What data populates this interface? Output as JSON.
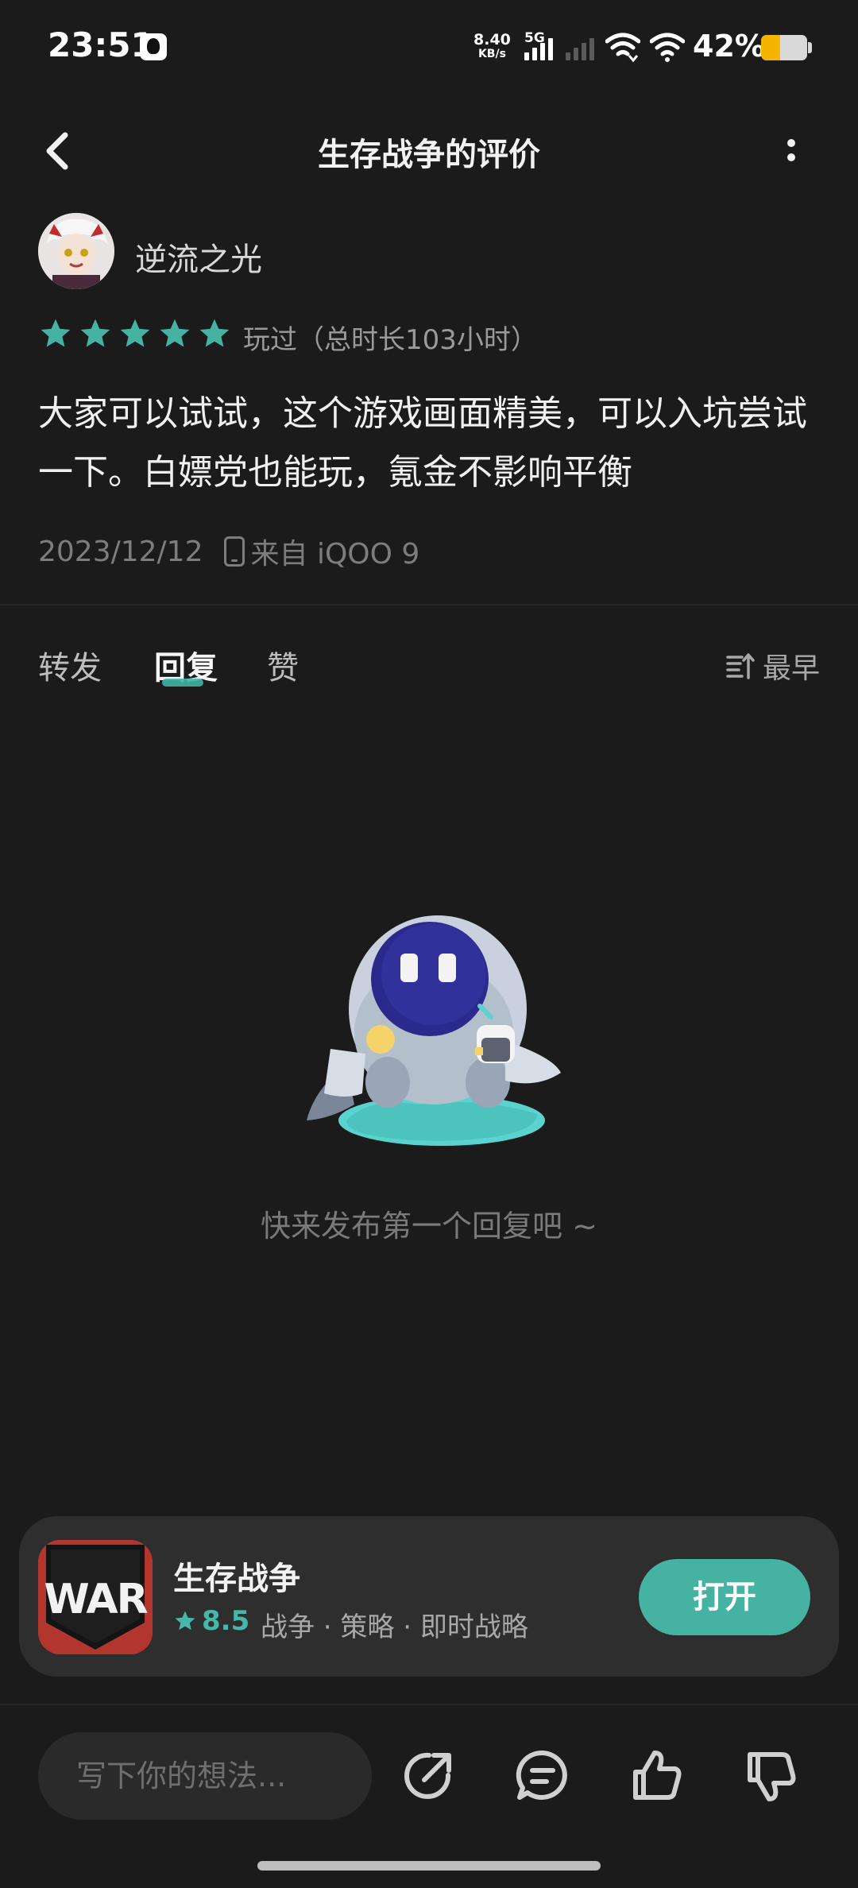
{
  "status_bar": {
    "time": "23:51",
    "net_speed_value": "8.40",
    "net_speed_unit": "KB/s",
    "network_type": "5G",
    "battery_percent_text": "42%",
    "battery_level": 0.42
  },
  "header": {
    "title": "生存战争的评价"
  },
  "review": {
    "username": "逆流之光",
    "stars": 5,
    "played": "玩过（总时长103小时）",
    "text": "大家可以试试，这个游戏画面精美，可以入坑尝试一下。白嫖党也能玩，氪金不影响平衡",
    "date": "2023/12/12",
    "device": "来自 iQOO 9"
  },
  "tabs": {
    "items": [
      {
        "label": "转发"
      },
      {
        "label": "回复"
      },
      {
        "label": "赞"
      }
    ],
    "active_index": 1,
    "sort_label": "最早"
  },
  "empty_state": {
    "text": "快来发布第一个回复吧 ~"
  },
  "game_card": {
    "name": "生存战争",
    "rating": "8.5",
    "tags": "战争 · 策略 · 即时战略",
    "open_label": "打开",
    "icon_text": "WAR"
  },
  "bottom_bar": {
    "input_placeholder": "写下你的想法..."
  },
  "colors": {
    "accent": "#45b2a2",
    "background": "#1b1b1b",
    "card": "#2e2e2e"
  }
}
